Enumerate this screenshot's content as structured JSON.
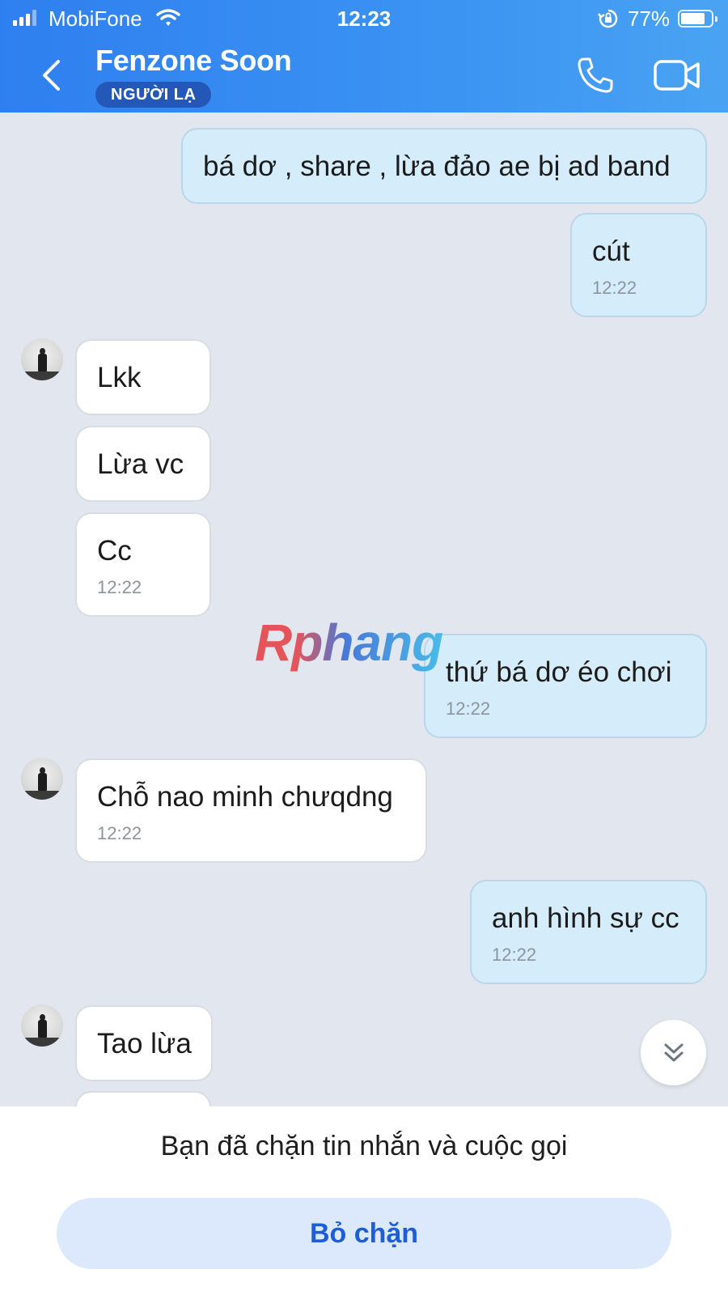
{
  "status_bar": {
    "carrier": "MobiFone",
    "time": "12:23",
    "battery": "77%",
    "battery_level": 0.77
  },
  "header": {
    "contact_name": "Fenzone Soon",
    "badge": "NGƯỜI LẠ",
    "colors": {
      "gradient_start": "#2f7ff0",
      "gradient_end": "#4aa3f2",
      "badge_bg": "#2458b8"
    }
  },
  "messages": [
    {
      "direction": "out",
      "text": "bá dơ , share , lừa đảo ae bị ad band",
      "time": ""
    },
    {
      "direction": "out",
      "text": "cút",
      "time": "12:22"
    },
    {
      "direction": "in",
      "text": "Lkk",
      "time": ""
    },
    {
      "direction": "in",
      "text": "Lừa vc",
      "time": ""
    },
    {
      "direction": "in",
      "text": "Cc",
      "time": "12:22"
    },
    {
      "direction": "out",
      "text": "thứ bá dơ éo  chơi",
      "time": "12:22"
    },
    {
      "direction": "in",
      "text": "Chỗ nao minh chưqdng",
      "time": "12:22"
    },
    {
      "direction": "out",
      "text": "anh hình sự cc",
      "time": "12:22"
    },
    {
      "direction": "in",
      "text": "Tao lừa",
      "time": ""
    }
  ],
  "watermark": "Rphang",
  "footer": {
    "blocked_message": "Bạn đã chặn tin nhắn và cuộc gọi",
    "unblock_label": "Bỏ chặn"
  },
  "colors": {
    "chat_bg": "#e2e7ef",
    "outgoing_bubble": "#d5ecfb",
    "incoming_bubble": "#ffffff",
    "accent": "#1d5ed8"
  },
  "icons": [
    "signal-icon",
    "wifi-icon",
    "rotation-lock-icon",
    "battery-icon",
    "back-icon",
    "phone-icon",
    "video-call-icon",
    "chevron-double-down-icon"
  ]
}
